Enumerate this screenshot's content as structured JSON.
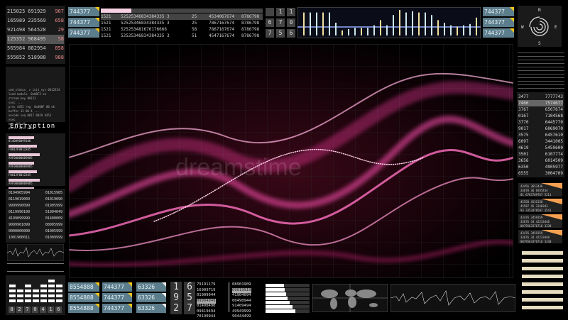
{
  "left_top_rows": [
    [
      "215025",
      "691929",
      "907"
    ],
    [
      "165989",
      "235569",
      "658"
    ],
    [
      "921498",
      "564528",
      "29"
    ],
    [
      "125352",
      "968495",
      "58"
    ],
    [
      "565984",
      "882954",
      "858"
    ],
    [
      "555852",
      "518988",
      "988"
    ]
  ],
  "left_log_lines": [
    "cmd_status_ > init_sys 0012334",
    "load module  0x00F3 ok",
    "stream key 00123",
    "sync ...",
    "proc 4455 reg  0x000F 00 ok",
    "buffer 12 00 4 ...",
    "encode seq 0017 0029 4453",
    "exec",
    "key 889 00",
    "parse 0034 end"
  ],
  "encryption": {
    "title": "Encryption",
    "items": [
      "0140090099186",
      "F0012F0012345",
      "A9F00000009885",
      "A9F00000009885",
      "F0012F0012345",
      "A9F00000009885",
      "F00125000000"
    ]
  },
  "left_num_rows": [
    [
      "0194905994",
      "01015905"
    ],
    [
      "0119019009",
      "01019090"
    ],
    [
      "9999990099",
      "01905999"
    ],
    [
      "0119990199",
      "51904049"
    ],
    [
      "4199099999",
      "01400009"
    ],
    [
      "9099901099",
      "00005999"
    ],
    [
      "0000000000",
      "01005999"
    ],
    [
      "1001900011",
      "01009999"
    ]
  ],
  "equalizer": {
    "digits": [
      "8",
      "2",
      "7",
      "0",
      "4",
      "1",
      "6"
    ],
    "levels": [
      4,
      3,
      4,
      3,
      4,
      5,
      4
    ]
  },
  "top_tags": [
    "744377",
    "744377",
    "744377"
  ],
  "top_table": {
    "progress": 0.19,
    "rows": [
      [
        "1521",
        "52525346834384335 3",
        "25",
        "4534067674",
        "8786798"
      ],
      [
        "1521",
        "52525346834384335 3",
        "25",
        "7867167674",
        "8786798"
      ],
      [
        "1521",
        "525253481676176666",
        "58",
        "7867167674",
        "8786798"
      ],
      [
        "1521",
        "52525346834384335 3",
        "51",
        "4547167674",
        "8786798"
      ]
    ]
  },
  "digit_grid": [
    "",
    "1",
    "1",
    "6",
    "7",
    "0",
    "7",
    "5",
    "6"
  ],
  "spectrum": {
    "levels": [
      0.9,
      0.9,
      0.9,
      0.9,
      0.9,
      0.5,
      0.2,
      0.25,
      0.3,
      0.3,
      0.3,
      0.4,
      0.6,
      0.4,
      0.8,
      1.0,
      0.9,
      0.95,
      0.9,
      0.9,
      0.8,
      0.6,
      0.5,
      0.4,
      0.35,
      0.4,
      0.45,
      0.7
    ]
  },
  "right_tags": [
    "744377",
    "744377",
    "744377"
  ],
  "compass": {
    "n": "N",
    "e": "E",
    "s": "S",
    "w": "W"
  },
  "right_numbers": [
    [
      "3477",
      "7777743"
    ],
    [
      "7466",
      "7574677"
    ],
    [
      "3767",
      "6507674"
    ],
    [
      "0167",
      "7104568"
    ],
    [
      "3770",
      "6445770"
    ],
    [
      "9017",
      "6069070"
    ],
    [
      "3575",
      "6457610"
    ],
    [
      "6097",
      "3441005"
    ],
    [
      "4619",
      "5459600"
    ],
    [
      "3501",
      "6107774"
    ],
    [
      "3656",
      "6014509"
    ],
    [
      "6350",
      "4905977"
    ],
    [
      "6555",
      "3004709"
    ]
  ],
  "right_cards": [
    [
      "43456 3653436",
      "33678 36 6935434",
      "01 6765769767 5211"
    ],
    [
      "45550 4531330",
      "45587 45 3330343",
      "93 3353470507 3541"
    ],
    [
      "43476 3459359",
      "33676 34 42233440",
      "0079563376710 3330"
    ],
    [
      "43476 3459359",
      "33676 34 42233440",
      "0079563376710 3330"
    ]
  ],
  "bottom_tags": [
    [
      "8554888",
      "744377",
      "63326"
    ],
    [
      "8554888",
      "744377",
      "63326"
    ],
    [
      "8554888",
      "744377",
      "63326"
    ]
  ],
  "bottom_digits": [
    [
      "1",
      "6"
    ],
    [
      "9",
      "5"
    ],
    [
      "2",
      "7"
    ]
  ],
  "bottom_col1": [
    "79191179",
    "16909719",
    "01909944",
    "09904949",
    "01490490",
    "09419494",
    "70190944"
  ],
  "bottom_col2": [
    "08901909",
    "09019919",
    "41904094",
    "00490944",
    "91409494",
    "49949999",
    "90444499"
  ],
  "bottom_bars": [
    0.42,
    0.44,
    0.46,
    0.5,
    0.55,
    0.62,
    0.68
  ],
  "watermark": "dreamstime"
}
